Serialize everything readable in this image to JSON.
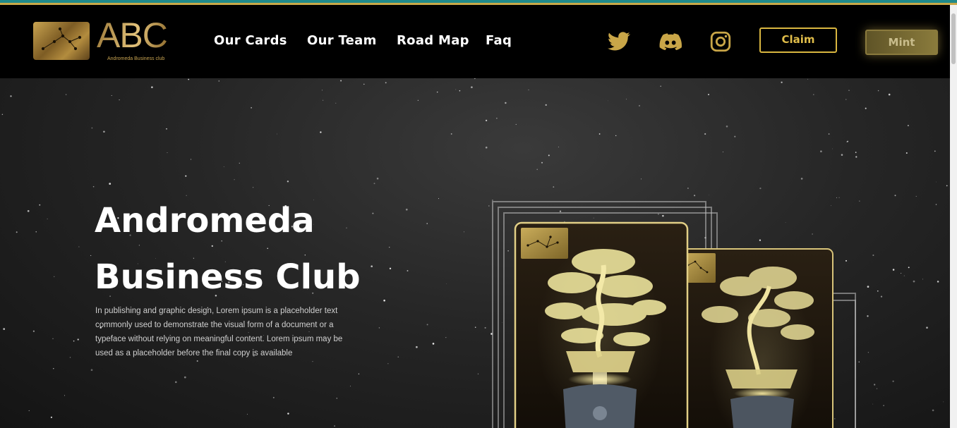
{
  "brand": {
    "logo_text": "ABC",
    "logo_subtitle": "Andromeda Business club",
    "gold": "#c9a451"
  },
  "nav": {
    "items": [
      {
        "label": "Our Cards"
      },
      {
        "label": "Our Team"
      },
      {
        "label": "Road Map"
      },
      {
        "label": "Faq"
      }
    ]
  },
  "social": {
    "icons": [
      "twitter-icon",
      "discord-icon",
      "instagram-icon"
    ]
  },
  "buttons": {
    "claim_label": "Claim",
    "mint_label": "Mint"
  },
  "hero": {
    "title_line1": "Andromeda",
    "title_line2": "Business Club",
    "description": "In publishing and graphic design, Lorem ipsum is a placeholder text commonly used to demonstrate the visual form of a document or a typeface without relying on meaningful content. Lorem ipsum may be used as a placeholder before the final copy is available"
  }
}
